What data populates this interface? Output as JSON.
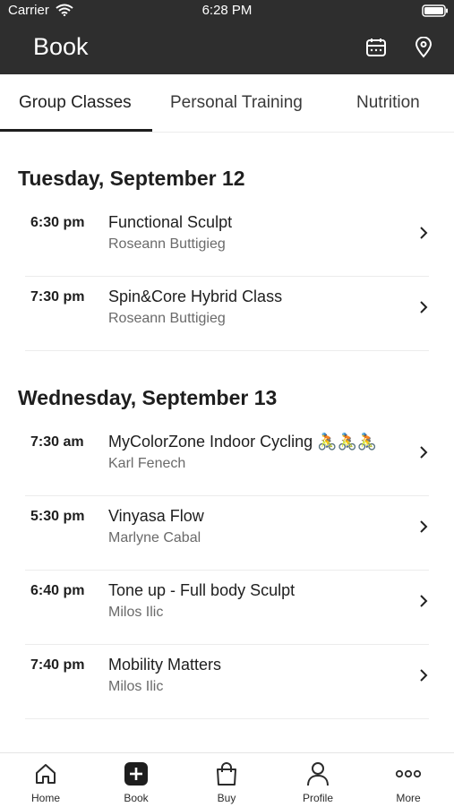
{
  "status": {
    "carrier": "Carrier",
    "time": "6:28 PM"
  },
  "header": {
    "title": "Book"
  },
  "tabs": [
    {
      "label": "Group Classes"
    },
    {
      "label": "Personal Training"
    },
    {
      "label": "Nutrition"
    }
  ],
  "days": [
    {
      "heading": "Tuesday, September 12",
      "classes": [
        {
          "time": "6:30 pm",
          "name": "Functional Sculpt",
          "instructor": "Roseann Buttigieg"
        },
        {
          "time": "7:30 pm",
          "name": "Spin&Core Hybrid Class",
          "instructor": "Roseann Buttigieg"
        }
      ]
    },
    {
      "heading": "Wednesday, September 13",
      "classes": [
        {
          "time": "7:30 am",
          "name": "MyColorZone Indoor Cycling 🚴🚴🚴",
          "instructor": "Karl Fenech"
        },
        {
          "time": "5:30 pm",
          "name": "Vinyasa Flow",
          "instructor": "Marlyne Cabal"
        },
        {
          "time": "6:40 pm",
          "name": "Tone up - Full body Sculpt",
          "instructor": "Milos Ilic"
        },
        {
          "time": "7:40 pm",
          "name": "Mobility Matters",
          "instructor": "Milos Ilic"
        }
      ]
    }
  ],
  "tabbar": [
    {
      "label": "Home",
      "icon": "home-icon"
    },
    {
      "label": "Book",
      "icon": "book-plus-icon"
    },
    {
      "label": "Buy",
      "icon": "shopping-bag-icon"
    },
    {
      "label": "Profile",
      "icon": "profile-icon"
    },
    {
      "label": "More",
      "icon": "more-icon"
    }
  ],
  "colors": {
    "header_bg": "#2e2e2e",
    "text": "#1e1e1e",
    "secondary_text": "#6a6a6a"
  }
}
